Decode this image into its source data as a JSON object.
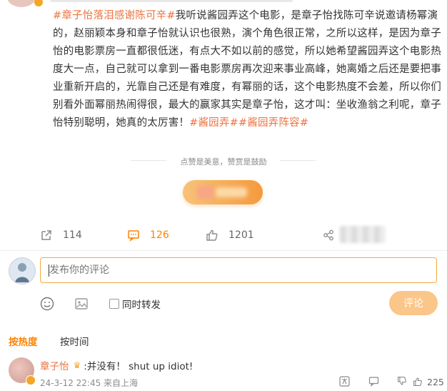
{
  "post": {
    "tag_start": "#章子怡落泪感谢陈可辛#",
    "body": "我听说酱园弄这个电影，是章子怡找陈可辛说邀请杨幂演的，赵丽颖本身和章子怡就认识也很熟，演个角色很正常，之所以这样，是因为章子怡的电影票房一直都很低迷，有点大不如以前的感觉，所以她希望酱园弄这个电影热度大一点，自己就可以拿到一番电影票房再次迎来事业高峰，她离婚之后还是要把事业重新开启的，光靠自己还是有难度，有幂丽的话，这个电影热度不会差，所以你们别看外面幂丽热闹得很，最大的赢家其实是章子怡，这才叫：坐收渔翁之利呢，章子怡特别聪明，她真的太厉害！",
    "tag_end": "#酱园弄##酱园弄阵容#"
  },
  "reward": {
    "tip": "点赞是美意，赞赏是鼓励"
  },
  "actions": {
    "repost_count": "114",
    "comment_count": "126",
    "like_count": "1201"
  },
  "composer": {
    "placeholder": "发布你的评论",
    "repost_label": "同时转发",
    "submit_label": "评论"
  },
  "sort": {
    "hot_label": "按热度",
    "time_label": "按时间"
  },
  "comments": [
    {
      "user": "章子怡",
      "text": ":并没有！ shut up idiot!",
      "meta": "24-3-12 22:45 来自上海",
      "likes": "225"
    }
  ],
  "colors": {
    "accent": "#ff8200",
    "tag": "#eb7340",
    "submit_disabled": "#fbc689"
  }
}
